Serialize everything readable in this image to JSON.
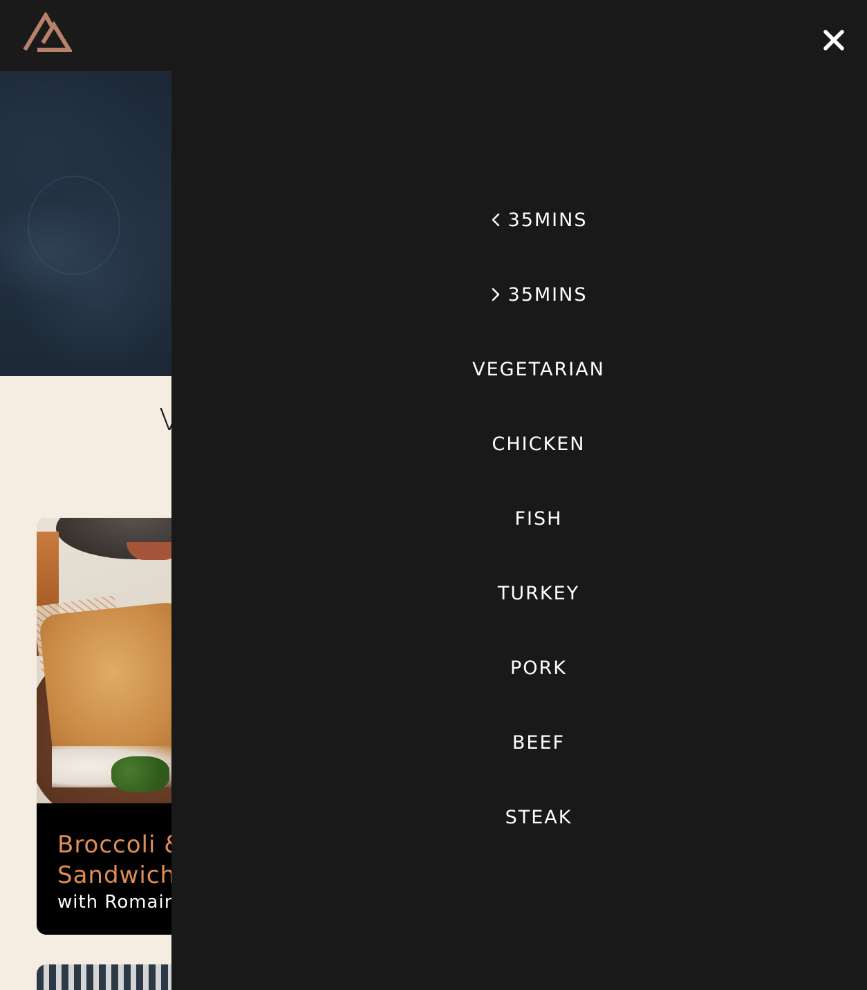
{
  "header": {
    "logo_name": "brand-logo",
    "logo_color": "#b8816a"
  },
  "main": {
    "heading_partial": "V"
  },
  "recipe_card": {
    "title_line1": "Broccoli &",
    "title_line2": "Sandwich",
    "subtitle": "with Romain",
    "title_color": "#e28d56"
  },
  "menu": {
    "close_icon": "close-icon",
    "items": [
      {
        "icon": "chevron-left-icon",
        "label": "35MINS"
      },
      {
        "icon": "chevron-right-icon",
        "label": "35MINS"
      },
      {
        "icon": "",
        "label": "VEGETARIAN"
      },
      {
        "icon": "",
        "label": "CHICKEN"
      },
      {
        "icon": "",
        "label": "FISH"
      },
      {
        "icon": "",
        "label": "TURKEY"
      },
      {
        "icon": "",
        "label": "PORK"
      },
      {
        "icon": "",
        "label": "BEEF"
      },
      {
        "icon": "",
        "label": "STEAK"
      }
    ]
  },
  "colors": {
    "page_background": "#f5ede2",
    "menu_background": "#191919",
    "menu_text": "#ffffff"
  }
}
